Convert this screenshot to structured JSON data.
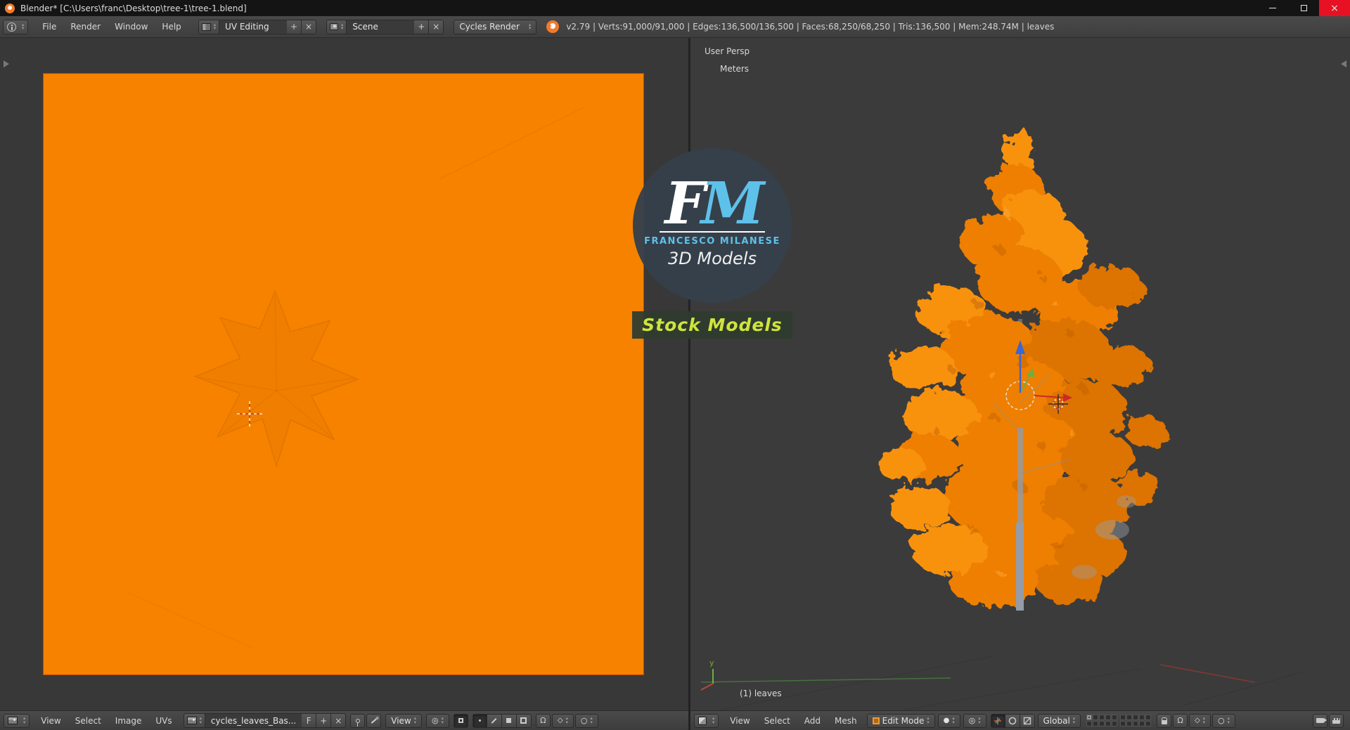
{
  "titlebar": {
    "title": "Blender* [C:\\Users\\franc\\Desktop\\tree-1\\tree-1.blend]"
  },
  "infobar": {
    "menus": [
      "File",
      "Render",
      "Window",
      "Help"
    ],
    "layout_value": "UV Editing",
    "scene_value": "Scene",
    "engine_value": "Cycles Render",
    "stats": "v2.79 | Verts:91,000/91,000 | Edges:136,500/136,500 | Faces:68,250/68,250 | Tris:136,500 | Mem:248.74M | leaves"
  },
  "uv_editor": {
    "menus": [
      "View",
      "Select",
      "Image",
      "UVs"
    ],
    "image_name": "cycles_leaves_Bas...",
    "fake_user_label": "F",
    "mode_value": "View"
  },
  "view3d": {
    "view_name": "User Persp",
    "unit_system": "Meters",
    "object_info": "(1) leaves",
    "axis_y_label": "y",
    "menus": [
      "View",
      "Select",
      "Add",
      "Mesh"
    ],
    "mode_value": "Edit Mode",
    "orientation_value": "Global"
  },
  "watermark": {
    "initials_f": "F",
    "initials_m": "M",
    "author": "FRANCESCO MILANESE",
    "subtitle": "3D Models",
    "banner": "Stock Models"
  },
  "icons": {
    "arrow_up": "▴",
    "arrow_down": "▾",
    "plus": "+",
    "close": "×",
    "magnet": "Ω",
    "sphere": "●",
    "pivot": "◎",
    "proportional": "○",
    "snap_element": "◇"
  },
  "colors": {
    "image_orange": "#f68200",
    "tree_orange": "#ef7f00",
    "tree_orange_light": "#f89210",
    "tree_orange_dark": "#dd7300",
    "trunk_gray": "#949ca8",
    "watermark_blue": "#5ec1ea",
    "banner_yellow": "#cfe43c",
    "close_red": "#e81123",
    "axis_x_red": "#c0453c",
    "axis_y_green": "#6fae3f",
    "axis_z_blue": "#3a66d6"
  }
}
